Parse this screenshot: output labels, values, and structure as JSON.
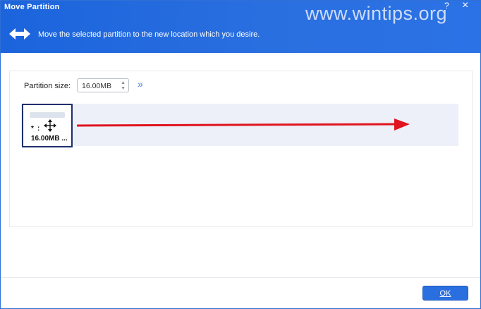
{
  "window": {
    "title": "Move Partition",
    "help_label": "?",
    "close_label": "×"
  },
  "watermark": "www.wintips.org",
  "header": {
    "icon": "move-left-right-icon",
    "subtitle": "Move the selected partition to the new location which you desire."
  },
  "partition_size": {
    "label": "Partition size:",
    "value": "16.00MB"
  },
  "partition_block": {
    "star": "*",
    "colon": ":",
    "size": "16.00MB ..."
  },
  "buttons": {
    "ok": "OK"
  },
  "colors": {
    "header_blue": "#2a6fe0",
    "arrow_red": "#e0131f",
    "partition_border": "#1f2f6e",
    "track_bg": "#edf0f8"
  }
}
